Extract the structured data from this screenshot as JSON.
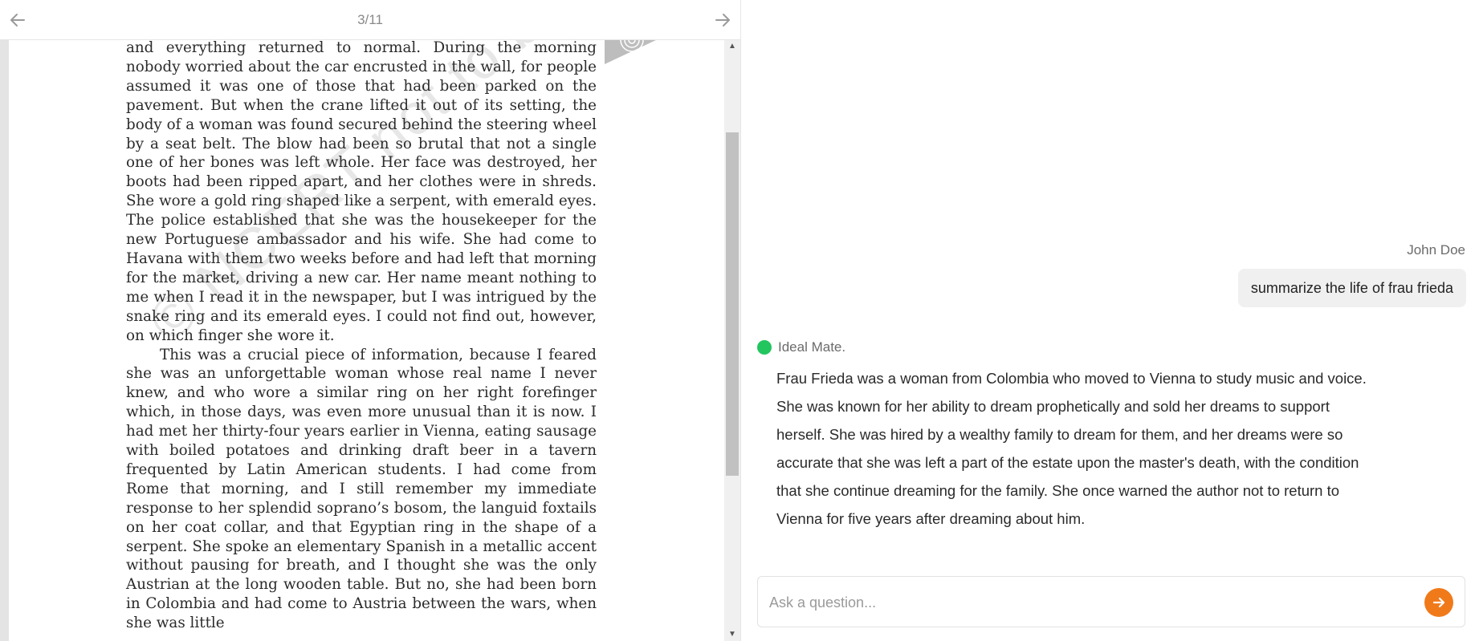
{
  "reader": {
    "page_indicator": "3/11",
    "paragraphs": [
      "and everything returned to normal. During the morning nobody worried about the car encrusted in the wall, for people assumed it was one of those that had been parked on the pavement. But when the crane lifted it out of its setting, the body of a woman was found secured behind the steering wheel by a seat belt. The blow had been so brutal that not a single one of her bones was left whole. Her face was destroyed, her boots had been ripped apart, and her clothes were in shreds. She wore a gold ring shaped like a serpent, with emerald eyes. The police established that she was the housekeeper for the new Portuguese ambassador and his wife. She had come to Havana with them two weeks before and had left that morning for the market, driving a new car. Her name meant nothing to me when I read it in the newspaper, but I was intrigued by the snake ring and its emerald eyes. I could not find out, however, on which finger she wore it.",
      "This was a crucial piece of information, because I feared she was an unforgettable woman whose real name I never knew, and who wore a similar ring on her right forefinger which, in those days, was even more unusual than it is now. I had met her thirty-four years earlier in Vienna, eating sausage with boiled potatoes and drinking draft beer in a tavern frequented by Latin American students. I had come from Rome that morning, and I still remember my immediate response to her splendid soprano’s bosom, the languid foxtails on her coat collar, and that Egyptian ring in the shape of a serpent. She spoke an elementary Spanish in a metallic accent without pausing for breath, and I thought she was the only Austrian at the long wooden table. But no, she had been born in Colombia and had come to Austria between the wars, when she was little"
    ],
    "watermark": "© NCERT not to be republished"
  },
  "chat": {
    "user_name": "John Doe",
    "user_message": "summarize the life of frau frieda",
    "bot_name": "Ideal Mate.",
    "bot_message": "Frau Frieda was a woman from Colombia who moved to Vienna to study music and voice. She was known for her ability to dream prophetically and sold her dreams to support herself. She was hired by a wealthy family to dream for them, and her dreams were so accurate that she was left a part of the estate upon the master's death, with the condition that she continue dreaming for the family. She once warned the author not to return to Vienna for five years after dreaming about him.",
    "input_placeholder": "Ask a question...",
    "status_color": "#22c55e",
    "send_color": "#f07a1a"
  }
}
